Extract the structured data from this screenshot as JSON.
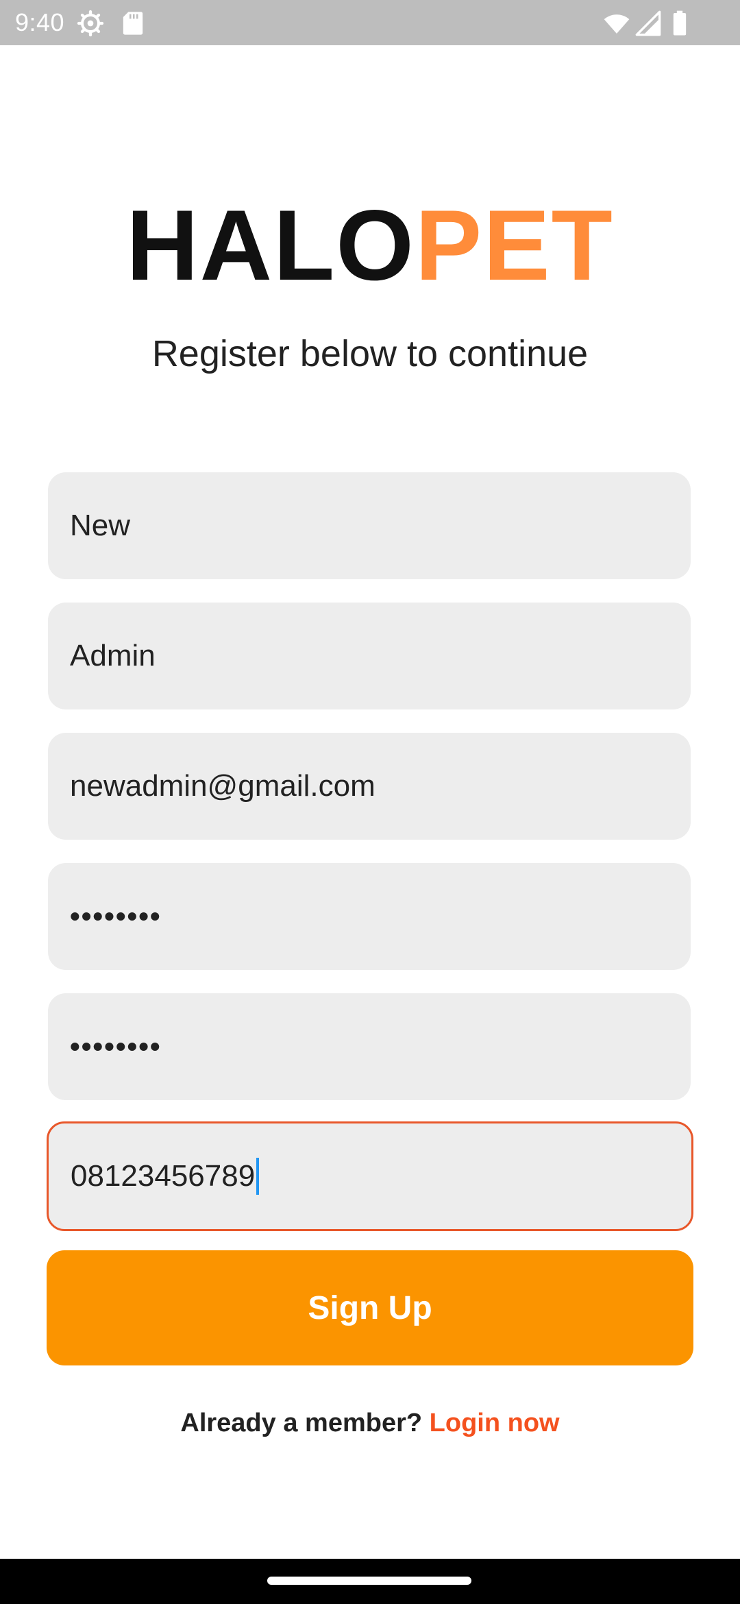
{
  "status_bar": {
    "time": "9:40",
    "icons": [
      "settings-icon",
      "sd-card-icon",
      "wifi-icon",
      "signal-icon",
      "battery-icon"
    ]
  },
  "logo": {
    "part1": "HALO",
    "part2": "PET",
    "colors": {
      "part1": "#111111",
      "part2": "#ff8c3a"
    }
  },
  "subtitle": "Register below to continue",
  "form": {
    "first_name": "New",
    "last_name": "Admin",
    "email": "newadmin@gmail.com",
    "password": "••••••••",
    "confirm_password": "••••••••",
    "phone": "08123456789"
  },
  "signup_button": "Sign Up",
  "footer": {
    "prompt": "Already a member?",
    "link": "Login now"
  },
  "colors": {
    "accent": "#fb9400",
    "link": "#f4511e",
    "focus_border": "#e8572a",
    "field_bg": "#ededed",
    "caret": "#2196f3"
  }
}
